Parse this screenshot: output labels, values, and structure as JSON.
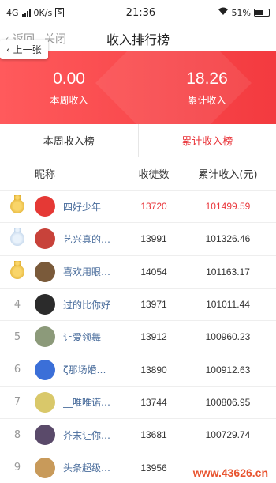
{
  "status_bar": {
    "network": "4G",
    "speed": "0K/s",
    "sim_badge": "S",
    "time": "21:36",
    "battery": "51%"
  },
  "title_bar": {
    "back_label": "返回",
    "close_label": "关闭",
    "title": "收入排行榜",
    "prev_popup": "上一张"
  },
  "banner": {
    "weekly_value": "0.00",
    "weekly_label": "本周收入",
    "total_value": "18.26",
    "total_label": "累计收入"
  },
  "tabs": [
    {
      "label": "本周收入榜",
      "active": false
    },
    {
      "label": "累计收入榜",
      "active": true
    }
  ],
  "list_header": {
    "nickname": "昵称",
    "fans": "收徒数",
    "income": "累计收入(元)"
  },
  "rows": [
    {
      "rank": "",
      "medal": "gold",
      "name": "四好少年",
      "fans": "13720",
      "income": "101499.59",
      "avatar_color": "#e53935"
    },
    {
      "rank": "",
      "medal": "silver",
      "name": "艺兴真的…",
      "fans": "13991",
      "income": "101326.46",
      "avatar_color": "#c8423a"
    },
    {
      "rank": "",
      "medal": "gold",
      "name": "喜欢用眼…",
      "fans": "14054",
      "income": "101163.17",
      "avatar_color": "#7a5a3a"
    },
    {
      "rank": "4",
      "medal": "",
      "name": "过的比你好",
      "fans": "13971",
      "income": "101011.44",
      "avatar_color": "#2b2b2b"
    },
    {
      "rank": "5",
      "medal": "",
      "name": "让爱领舞",
      "fans": "13912",
      "income": "100960.23",
      "avatar_color": "#8c9a7a"
    },
    {
      "rank": "6",
      "medal": "",
      "name": "ζ那场婚…",
      "fans": "13890",
      "income": "100912.63",
      "avatar_color": "#3b6fd8"
    },
    {
      "rank": "7",
      "medal": "",
      "name": "__唯唯诺…",
      "fans": "13744",
      "income": "100806.95",
      "avatar_color": "#d9c86a"
    },
    {
      "rank": "8",
      "medal": "",
      "name": "芥末让你…",
      "fans": "13681",
      "income": "100729.74",
      "avatar_color": "#5a4a6a"
    },
    {
      "rank": "9",
      "medal": "",
      "name": "头条超级…",
      "fans": "13956",
      "income": "",
      "avatar_color": "#c89a5a"
    }
  ],
  "watermark": "www.43626.cn"
}
